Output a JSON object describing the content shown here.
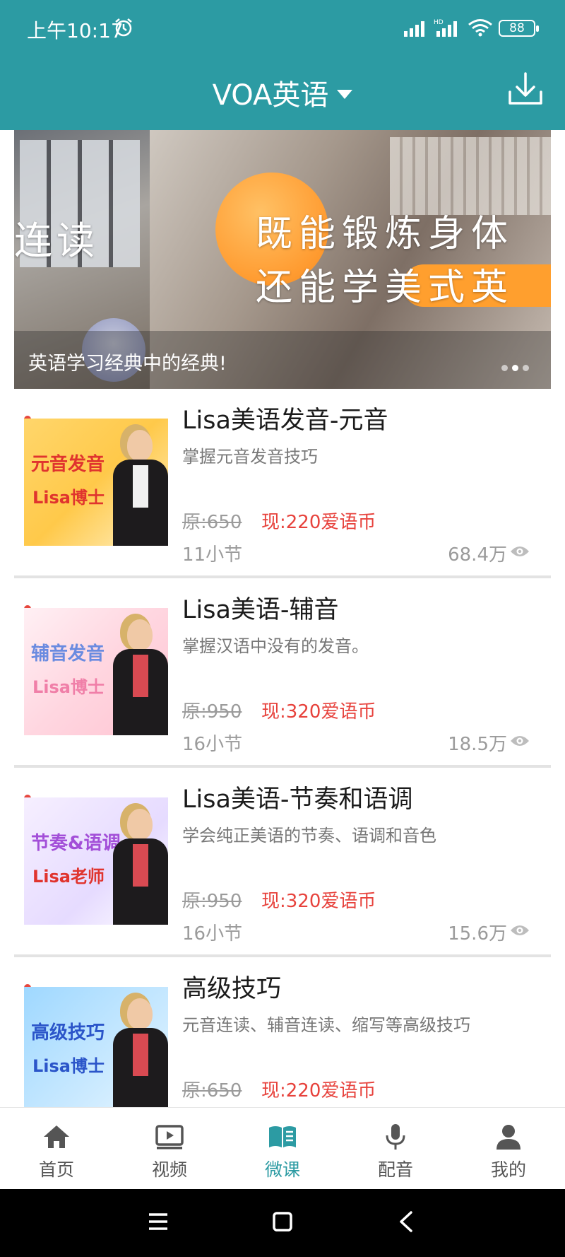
{
  "status_bar": {
    "time": "上午10:17",
    "battery": "88"
  },
  "header": {
    "title": "VOA英语"
  },
  "banner": {
    "left_text": "连读",
    "line1": "既能锻炼身体",
    "line2": "还能学美式英",
    "caption": "英语学习经典中的经典!"
  },
  "courses": [
    {
      "title": "Lisa美语发音-元音",
      "subtitle": "掌握元音发音技巧",
      "original_price": "原:650",
      "current_price": "现:220爱语币",
      "lessons": "11小节",
      "views": "68.4万",
      "thumb_line1": "元音发音",
      "thumb_line2": "Lisa博士"
    },
    {
      "title": "Lisa美语-辅音",
      "subtitle": "掌握汉语中没有的发音。",
      "original_price": "原:950",
      "current_price": "现:320爱语币",
      "lessons": "16小节",
      "views": "18.5万",
      "thumb_line1": "辅音发音",
      "thumb_line2": "Lisa博士"
    },
    {
      "title": "Lisa美语-节奏和语调",
      "subtitle": "学会纯正美语的节奏、语调和音色",
      "original_price": "原:950",
      "current_price": "现:320爱语币",
      "lessons": "16小节",
      "views": "15.6万",
      "thumb_line1": "节奏&语调",
      "thumb_line2": "Lisa老师"
    },
    {
      "title": "高级技巧",
      "subtitle": "元音连读、辅音连读、缩写等高级技巧",
      "original_price": "原:650",
      "current_price": "现:220爱语币",
      "lessons": "",
      "views": "",
      "thumb_line1": "高级技巧",
      "thumb_line2": "Lisa博士"
    }
  ],
  "bottom_nav": [
    {
      "label": "首页",
      "icon": "home-icon"
    },
    {
      "label": "视频",
      "icon": "video-icon"
    },
    {
      "label": "微课",
      "icon": "book-icon",
      "active": true
    },
    {
      "label": "配音",
      "icon": "microphone-icon"
    },
    {
      "label": "我的",
      "icon": "person-icon"
    }
  ],
  "colors": {
    "primary": "#2c9ba3",
    "price_red": "#e7423c",
    "muted": "#9b9b9b"
  }
}
